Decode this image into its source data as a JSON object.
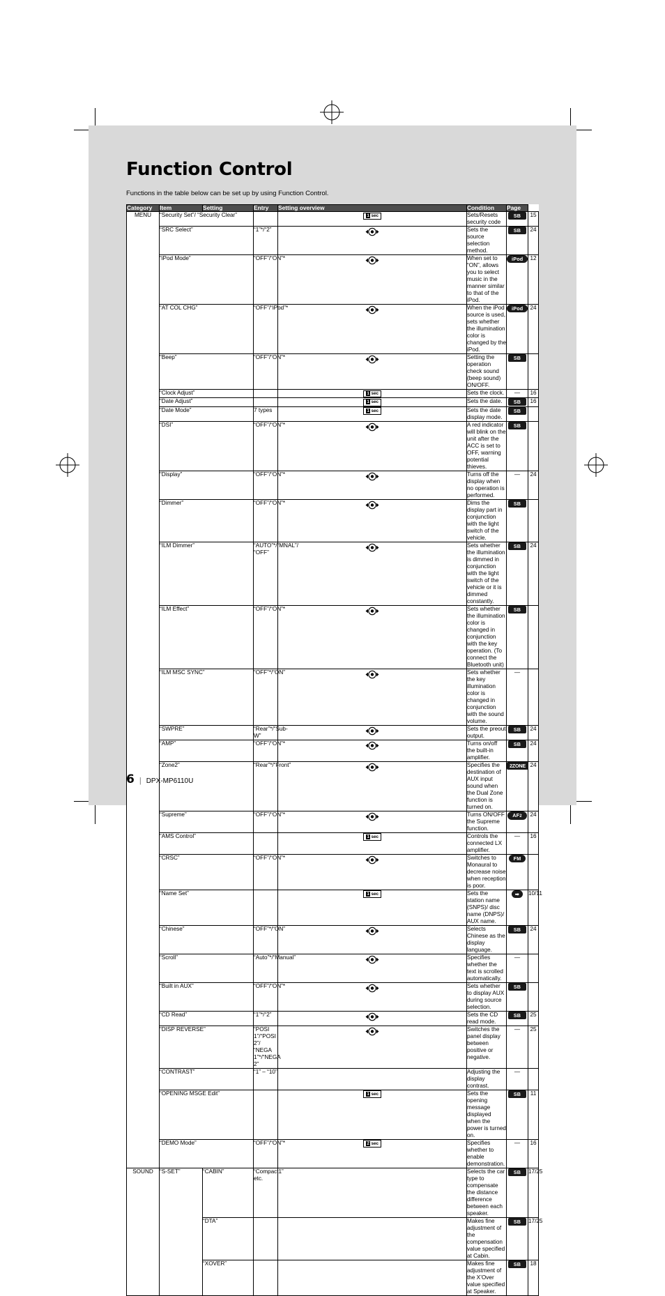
{
  "title": "Function Control",
  "intro": "Functions in the table below can be set up by using Function Control.",
  "table": {
    "headers": [
      "Category",
      "Item",
      "Setting",
      "Entry",
      "Setting overview",
      "Condition",
      "Page"
    ],
    "rows": [
      {
        "category": "MENU",
        "item": "“Security Set”/ “Security Clear”",
        "setting": "",
        "entry": "1sec",
        "overview": "Sets/Resets security code",
        "condition": "SB",
        "page": "15"
      },
      {
        "category": "",
        "item": "“SRC Select”",
        "setting": "“1”*/“2”",
        "entry": "knob",
        "overview": "Sets the source selection method.",
        "condition": "SB",
        "page": "24"
      },
      {
        "category": "",
        "item": "“iPod Mode”",
        "setting": "“OFF”/“ON”*",
        "entry": "knob",
        "overview": "When set to “ON”, allows you to select music in the manner similar to that of the iPod.",
        "condition": "iPod",
        "page": "12"
      },
      {
        "category": "",
        "item": "“AT COL CHG”",
        "setting": "“OFF”/“iPod”*",
        "entry": "knob",
        "overview": "When the iPod source is used, sets whether the illumination color is changed by the iPod.",
        "condition": "iPod",
        "page": "24"
      },
      {
        "category": "",
        "item": "“Beep”",
        "setting": "“OFF”/“ON”*",
        "entry": "knob",
        "overview": "Setting the operation check sound (beep sound) ON/OFF.",
        "condition": "SB",
        "page": ""
      },
      {
        "category": "",
        "item": "“Clock Adjust”",
        "setting": "",
        "entry": "1sec",
        "overview": "Sets the clock.",
        "condition": "—",
        "page": "16"
      },
      {
        "category": "",
        "item": "“Date Adjust”",
        "setting": "",
        "entry": "1sec",
        "overview": "Sets the date.",
        "condition": "SB",
        "page": "16"
      },
      {
        "category": "",
        "item": "“Date Mode”",
        "setting": "7 types",
        "entry": "1sec",
        "overview": "Sets the date display mode.",
        "condition": "SB",
        "page": ""
      },
      {
        "category": "",
        "item": "“DSI”",
        "setting": "“OFF”/“ON”*",
        "entry": "knob",
        "overview": "A red indicator will blink on the unit after the ACC is set to OFF, warning potential thieves.",
        "condition": "SB",
        "page": ""
      },
      {
        "category": "",
        "item": "“Display”",
        "setting": "“OFF”/“ON”*",
        "entry": "knob",
        "overview": "Turns off the display when no operation is performed.",
        "condition": "—",
        "page": "24"
      },
      {
        "category": "",
        "item": "“Dimmer”",
        "setting": "“OFF”/“ON”*",
        "entry": "knob",
        "overview": "Dims the display part in conjunction with the light switch of the vehicle.",
        "condition": "SB",
        "page": ""
      },
      {
        "category": "",
        "item": "“ILM Dimmer”",
        "setting": "“AUTO”*/“MNAL”/ “OFF”",
        "entry": "knob",
        "overview": "Sets whether the illumination is dimmed in conjunction with the light switch of the vehicle or it is dimmed constantly.",
        "condition": "SB",
        "page": "24"
      },
      {
        "category": "",
        "item": "“ILM Effect”",
        "setting": "“OFF”/“ON”*",
        "entry": "knob",
        "overview": "Sets whether the illumination color is changed in conjunction with the key operation. (To connect the Bluetooth unit)",
        "condition": "SB",
        "page": ""
      },
      {
        "category": "",
        "item": "“ILM MSC SYNC”",
        "setting": "“OFF”*/“ON”",
        "entry": "knob",
        "overview": "Sets whether the key illumination color is changed in conjunction with the sound volume.",
        "condition": "—",
        "page": ""
      },
      {
        "category": "",
        "item": "“SWPRE”",
        "setting": "“Rear”*/“Sub-W”",
        "entry": "knob",
        "overview": "Sets the preout output.",
        "condition": "SB",
        "page": "24"
      },
      {
        "category": "",
        "item": "“AMP”",
        "setting": "“OFF”/“ON”*",
        "entry": "knob",
        "overview": "Turns on/off the built-in amplifier.",
        "condition": "SB",
        "page": "24"
      },
      {
        "category": "",
        "item": "“Zone2”",
        "setting": "“Rear”*/“Front”",
        "entry": "knob",
        "overview": "Specifies the destination of AUX input sound when the Dual Zone function is turned on.",
        "condition": "2ZONE",
        "page": "24"
      },
      {
        "category": "",
        "item": "“Supreme”",
        "setting": "“OFF”/“ON”*",
        "entry": "knob",
        "overview": "Turns ON/OFF the Supreme function.",
        "condition": "AF2",
        "page": "24"
      },
      {
        "category": "",
        "item": "“AMS Control”",
        "setting": "",
        "entry": "1sec",
        "overview": "Controls the connected LX amplifier.",
        "condition": "—",
        "page": "16"
      },
      {
        "category": "",
        "item": "“CRSC”",
        "setting": "“OFF”/“ON”*",
        "entry": "knob",
        "overview": "Switches to Monaural to decrease noise when reception is poor.",
        "condition": "FM",
        "page": ""
      },
      {
        "category": "",
        "item": "“Name Set”",
        "setting": "",
        "entry": "1sec",
        "overview": "Sets the station name (SNPS)/ disc name (DNPS)/ AUX name.",
        "condition": "arrow",
        "page": "10/11"
      },
      {
        "category": "",
        "item": "“Chinese”",
        "setting": "“OFF”*/“ON”",
        "entry": "knob",
        "overview": "Selects Chinese as the display language.",
        "condition": "SB",
        "page": "24"
      },
      {
        "category": "",
        "item": "“Scroll”",
        "setting": "“Auto”*/“Manual”",
        "entry": "knob",
        "overview": "Specifies whether the text is scrolled automatically.",
        "condition": "—",
        "page": ""
      },
      {
        "category": "",
        "item": "“Built in AUX”",
        "setting": "“OFF”/“ON”*",
        "entry": "knob",
        "overview": "Sets whether to display AUX during source selection.",
        "condition": "SB",
        "page": ""
      },
      {
        "category": "",
        "item": "“CD Read”",
        "setting": "“1”*/“2”",
        "entry": "knob",
        "overview": "Sets the CD read mode.",
        "condition": "SB",
        "page": "25"
      },
      {
        "category": "",
        "item": "“DISP REVERSE”",
        "setting": "“POSI 1”/“POSI 2”/ “NEGA 1”*/“NEGA 2”",
        "entry": "knob",
        "overview": "Switches the panel display between positive or negative.",
        "condition": "—",
        "page": "25"
      },
      {
        "category": "",
        "item": "“CONTRAST”",
        "setting": "“1” – “10”",
        "entry": "",
        "overview": "Adjusting the display contrast.",
        "condition": "—",
        "page": ""
      },
      {
        "category": "",
        "item": "“OPENING MSGE Edit”",
        "setting": "",
        "entry": "1sec",
        "overview": "Sets the opening message displayed when the power is turned on.",
        "condition": "SB",
        "page": "11"
      },
      {
        "category": "",
        "item": "“DEMO Mode”",
        "setting": "“OFF”/“ON”*",
        "entry": "2sec",
        "overview": "Specifies whether to enable demonstration.",
        "condition": "—",
        "page": "16"
      },
      {
        "category": "SOUND",
        "item": "“S-SET”",
        "item2": "“CABIN”",
        "setting": "“Compact1” etc.",
        "entry": "",
        "overview": "Selects the car type to compensate the distance difference between each speaker.",
        "condition": "SB",
        "page": "17/25"
      },
      {
        "category": "",
        "item": "",
        "item2": "“DTA”",
        "setting": "",
        "entry": "",
        "overview": "Makes fine adjustment of the compensation value specified at Cabin.",
        "condition": "SB",
        "page": "17/25"
      },
      {
        "category": "",
        "item": "",
        "item2": "“XOVER”",
        "setting": "",
        "entry": "",
        "overview": "Makes fine adjustment of the X’Over value specified at Speaker.",
        "condition": "SB",
        "page": "18"
      }
    ]
  },
  "footer": {
    "page_number": "6",
    "model": "DPX-MP6110U"
  }
}
